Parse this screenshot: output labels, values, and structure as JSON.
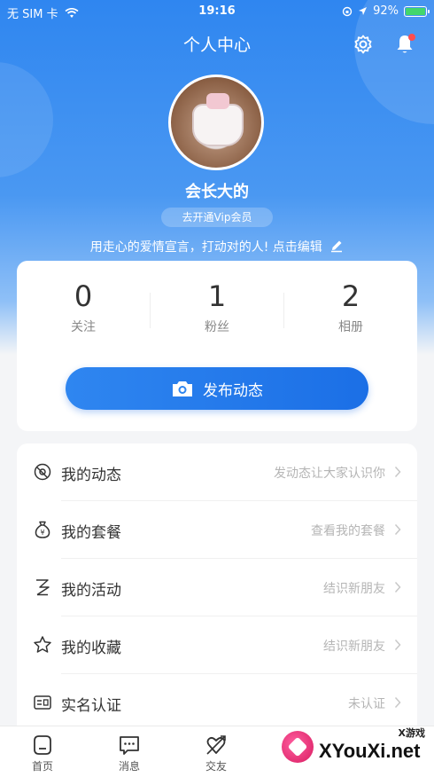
{
  "status_bar": {
    "carrier": "无 SIM 卡",
    "time": "19:16",
    "battery": "92%"
  },
  "header": {
    "title": "个人中心"
  },
  "profile": {
    "name": "会长大的",
    "vip_label": "去开通Vip会员",
    "motto": "用走心的爱情宣言，打动对的人! 点击编辑"
  },
  "stats": [
    {
      "value": "0",
      "label": "关注"
    },
    {
      "value": "1",
      "label": "粉丝"
    },
    {
      "value": "2",
      "label": "相册"
    }
  ],
  "post_button": {
    "label": "发布动态"
  },
  "menu": [
    {
      "label": "我的动态",
      "hint": "发动态让大家认识你",
      "icon": "moments-icon"
    },
    {
      "label": "我的套餐",
      "hint": "查看我的套餐",
      "icon": "money-bag-icon"
    },
    {
      "label": "我的活动",
      "hint": "结识新朋友",
      "icon": "activity-icon"
    },
    {
      "label": "我的收藏",
      "hint": "结识新朋友",
      "icon": "star-icon"
    },
    {
      "label": "实名认证",
      "hint": "未认证",
      "icon": "id-card-icon"
    }
  ],
  "tabbar": [
    {
      "label": "首页",
      "icon": "home-icon"
    },
    {
      "label": "消息",
      "icon": "message-icon"
    },
    {
      "label": "交友",
      "icon": "dating-icon"
    }
  ],
  "watermark": {
    "small": "X游戏",
    "big": "XYouXi.net"
  },
  "colors": {
    "primary": "#2f86f0",
    "badge": "#ff4d4f"
  }
}
